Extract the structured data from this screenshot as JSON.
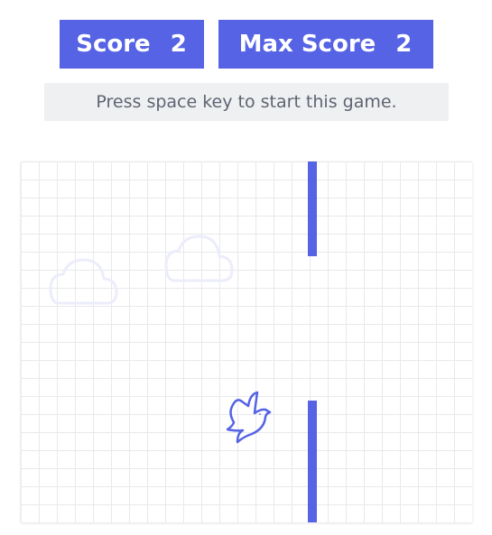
{
  "score": {
    "label": "Score",
    "value": "2"
  },
  "max_score": {
    "label": "Max Score",
    "value": "2"
  },
  "hint": "Press space key to start this game.",
  "colors": {
    "accent": "#5563e4",
    "hint_bg": "#eff0f2",
    "hint_text": "#5f6472",
    "grid_line": "#e8e9ec",
    "cloud": "#ecedfb"
  },
  "board": {
    "clouds": [
      "cloud-icon",
      "cloud-icon"
    ],
    "bird": "bird-icon",
    "pipes": [
      "top-pipe",
      "bottom-pipe"
    ]
  }
}
